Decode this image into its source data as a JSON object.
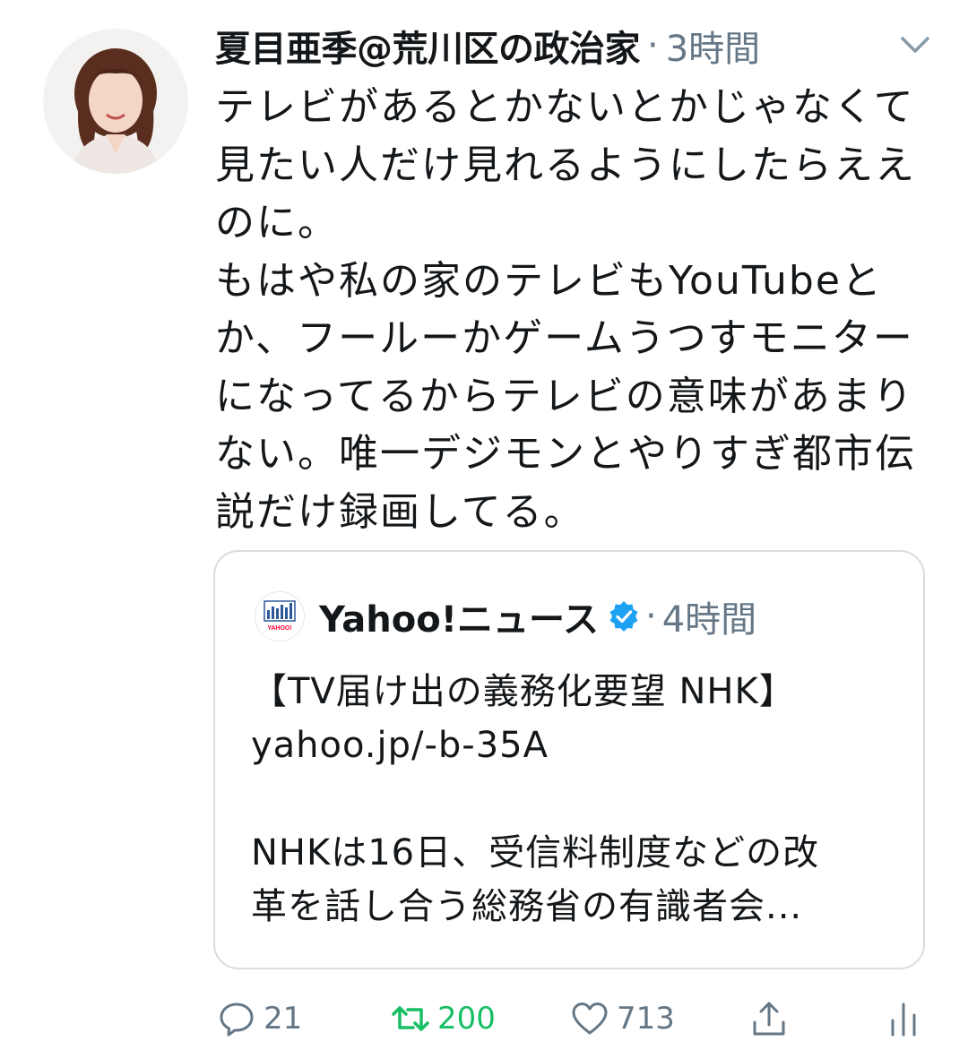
{
  "tweet": {
    "author_name": "夏目亜季@荒川区の政治家",
    "separator": "·",
    "time": "3時間",
    "text_lines": [
      "テレビがあるとかないとかじゃなくて",
      "見たい人だけ見れるようにしたらええ",
      "のに。",
      "もはや私の家のテレビもYouTubeと",
      "か、フールーかゲームうつすモニター",
      "になってるからテレビの意味があまり",
      "ない。唯一デジモンとやりすぎ都市伝",
      "説だけ録画してる。"
    ]
  },
  "quoted": {
    "author_name": "Yahoo!ニュース",
    "separator": "·",
    "time": "4時間",
    "text_lines": [
      "【TV届け出の義務化要望 NHK】",
      "yahoo.jp/-b-35A",
      "",
      "NHKは16日、受信料制度などの改",
      "革を話し合う総務省の有識者会..."
    ],
    "avatar_logo_text": "YAHOO!"
  },
  "actions": {
    "replies": "21",
    "retweets": "200",
    "likes": "713"
  },
  "icons": {
    "caret": "chevron-down-icon",
    "verified": "verified-badge-icon",
    "reply": "reply-icon",
    "retweet": "retweet-icon",
    "like": "heart-icon",
    "share": "share-icon",
    "analytics": "analytics-icon"
  },
  "colors": {
    "text": "#14171a",
    "secondary": "#657786",
    "retweet_active": "#17bf63",
    "verified": "#1da1f2",
    "border": "#d8dde2"
  }
}
